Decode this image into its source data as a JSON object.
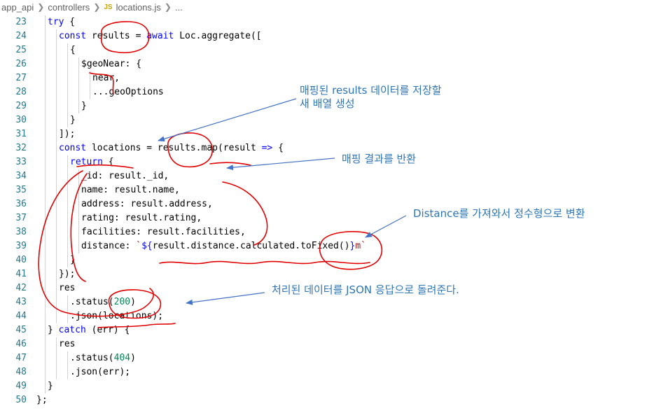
{
  "breadcrumb": {
    "folder1": "app_api",
    "folder2": "controllers",
    "file_badge": "JS",
    "file": "locations.js",
    "trail": "..."
  },
  "code_lines": [
    {
      "n": "23",
      "indent": 1,
      "tokens": [
        {
          "c": "k",
          "t": "try"
        },
        {
          "c": "",
          "t": " {"
        }
      ]
    },
    {
      "n": "24",
      "indent": 2,
      "tokens": [
        {
          "c": "k",
          "t": "const"
        },
        {
          "c": "",
          "t": " results = "
        },
        {
          "c": "k",
          "t": "await"
        },
        {
          "c": "",
          "t": " Loc.aggregate(["
        }
      ]
    },
    {
      "n": "25",
      "indent": 3,
      "tokens": [
        {
          "c": "",
          "t": "{"
        }
      ]
    },
    {
      "n": "26",
      "indent": 4,
      "tokens": [
        {
          "c": "",
          "t": "$geoNear: {"
        }
      ]
    },
    {
      "n": "27",
      "indent": 5,
      "tokens": [
        {
          "c": "",
          "t": "near,"
        }
      ]
    },
    {
      "n": "28",
      "indent": 5,
      "tokens": [
        {
          "c": "",
          "t": "...geoOptions"
        }
      ]
    },
    {
      "n": "29",
      "indent": 4,
      "tokens": [
        {
          "c": "",
          "t": "}"
        }
      ]
    },
    {
      "n": "30",
      "indent": 3,
      "tokens": [
        {
          "c": "",
          "t": "}"
        }
      ]
    },
    {
      "n": "31",
      "indent": 2,
      "tokens": [
        {
          "c": "",
          "t": "]);"
        }
      ]
    },
    {
      "n": "32",
      "indent": 2,
      "tokens": [
        {
          "c": "k",
          "t": "const"
        },
        {
          "c": "",
          "t": " locations = results.map(result "
        },
        {
          "c": "k",
          "t": "=>"
        },
        {
          "c": "",
          "t": " {"
        }
      ]
    },
    {
      "n": "33",
      "indent": 3,
      "tokens": [
        {
          "c": "k",
          "t": "return"
        },
        {
          "c": "",
          "t": " {"
        }
      ]
    },
    {
      "n": "34",
      "indent": 4,
      "tokens": [
        {
          "c": "",
          "t": "_id: result._id,"
        }
      ]
    },
    {
      "n": "35",
      "indent": 4,
      "tokens": [
        {
          "c": "",
          "t": "name: result.name,"
        }
      ]
    },
    {
      "n": "36",
      "indent": 4,
      "tokens": [
        {
          "c": "",
          "t": "address: result.address,"
        }
      ]
    },
    {
      "n": "37",
      "indent": 4,
      "tokens": [
        {
          "c": "",
          "t": "rating: result.rating,"
        }
      ]
    },
    {
      "n": "38",
      "indent": 4,
      "tokens": [
        {
          "c": "",
          "t": "facilities: result.facilities,"
        }
      ]
    },
    {
      "n": "39",
      "indent": 4,
      "tokens": [
        {
          "c": "",
          "t": "distance: "
        },
        {
          "c": "s",
          "t": "`"
        },
        {
          "c": "k",
          "t": "${"
        },
        {
          "c": "",
          "t": "result.distance.calculated.toFixed()"
        },
        {
          "c": "k",
          "t": "}"
        },
        {
          "c": "s",
          "t": "m`"
        }
      ]
    },
    {
      "n": "40",
      "indent": 3,
      "tokens": [
        {
          "c": "",
          "t": "}"
        }
      ]
    },
    {
      "n": "41",
      "indent": 2,
      "tokens": [
        {
          "c": "",
          "t": "});"
        }
      ]
    },
    {
      "n": "42",
      "indent": 2,
      "tokens": [
        {
          "c": "",
          "t": "res"
        }
      ]
    },
    {
      "n": "43",
      "indent": 3,
      "tokens": [
        {
          "c": "",
          "t": ".status("
        },
        {
          "c": "n",
          "t": "200"
        },
        {
          "c": "",
          "t": ")"
        }
      ]
    },
    {
      "n": "44",
      "indent": 3,
      "tokens": [
        {
          "c": "",
          "t": ".json(locations);"
        }
      ]
    },
    {
      "n": "45",
      "indent": 1,
      "tokens": [
        {
          "c": "",
          "t": "} "
        },
        {
          "c": "k",
          "t": "catch"
        },
        {
          "c": "",
          "t": " (err) {"
        }
      ]
    },
    {
      "n": "46",
      "indent": 2,
      "tokens": [
        {
          "c": "",
          "t": "res"
        }
      ]
    },
    {
      "n": "47",
      "indent": 3,
      "tokens": [
        {
          "c": "",
          "t": ".status("
        },
        {
          "c": "n",
          "t": "404"
        },
        {
          "c": "",
          "t": ")"
        }
      ]
    },
    {
      "n": "48",
      "indent": 3,
      "tokens": [
        {
          "c": "",
          "t": ".json(err);"
        }
      ]
    },
    {
      "n": "49",
      "indent": 1,
      "tokens": [
        {
          "c": "",
          "t": "}"
        }
      ]
    },
    {
      "n": "50",
      "indent": 0,
      "tokens": [
        {
          "c": "",
          "t": "};"
        }
      ]
    }
  ],
  "annotations": {
    "a1_line1": "매핑된 results 데이터를 저장할",
    "a1_line2": "새 배열 생성",
    "a2": "매핑 결과를 반환",
    "a3": "Distance를 가져와서 정수형으로 변환",
    "a4": "처리된 데이터를 JSON 응답으로 돌려준다."
  },
  "colors": {
    "annotation_text": "#2e75b6",
    "annotation_arrow": "#4472c4",
    "markup_red": "#e00000",
    "line_number": "#237893",
    "keyword": "#0000ff",
    "number": "#098658"
  }
}
